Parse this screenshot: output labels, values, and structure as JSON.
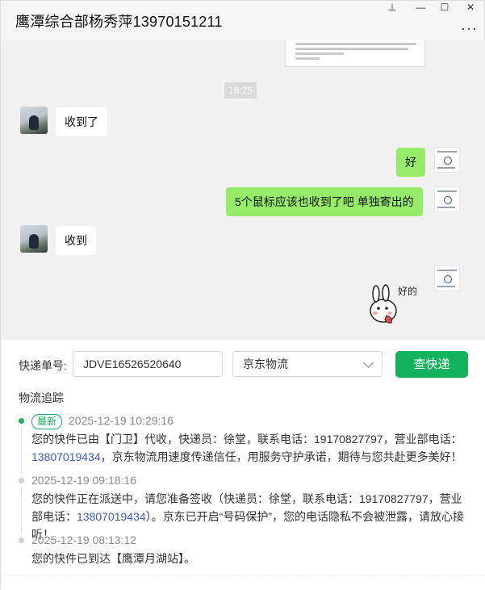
{
  "window": {
    "title": "鹰潭综合部杨秀萍13970151211",
    "pin_icon": "⊥",
    "minimize_icon": "—",
    "maximize_icon": "☐",
    "close_icon": "✕",
    "more_icon": "···"
  },
  "chat": {
    "time_chip": "16:25",
    "messages": [
      {
        "side": "left",
        "text": "收到了"
      },
      {
        "side": "right",
        "text": "好"
      },
      {
        "side": "right",
        "text": "5个鼠标应该也收到了吧  单独寄出的"
      },
      {
        "side": "left",
        "text": "收到"
      }
    ],
    "sticker_text": "好的"
  },
  "express": {
    "tracking_label": "快递单号:",
    "tracking_value": "JDVE16526520640",
    "carrier_selected": "京东物流",
    "query_button": "查快递",
    "section_title": "物流追踪",
    "events": [
      {
        "latest_badge": "最新",
        "time": "2025-12-19 10:29:16",
        "text_a": "您的快件已由【门卫】代收，快递员：徐堂，联系电话：19170827797，营业部电话：",
        "phone": "13807019434",
        "text_b": "，京东物流用速度传递信任，用服务守护承诺，期待与您共赴更多美好！"
      },
      {
        "time": "2025-12-19 09:18:16",
        "text_a": "您的快件正在派送中，请您准备签收（快递员：徐堂，联系电话：19170827797，营业部电话：",
        "phone": "13807019434",
        "text_b": "）。京东已开启“号码保护”，您的电话隐私不会被泄露，请放心接听！"
      },
      {
        "time": "2025-12-19 08:13:12",
        "text_a": "您的快件已到达【鹰潭月湖站】。"
      }
    ]
  },
  "colors": {
    "accent_green": "#13b25e",
    "bubble_green": "#95ec69",
    "phone_blue": "#3d5bbf"
  }
}
